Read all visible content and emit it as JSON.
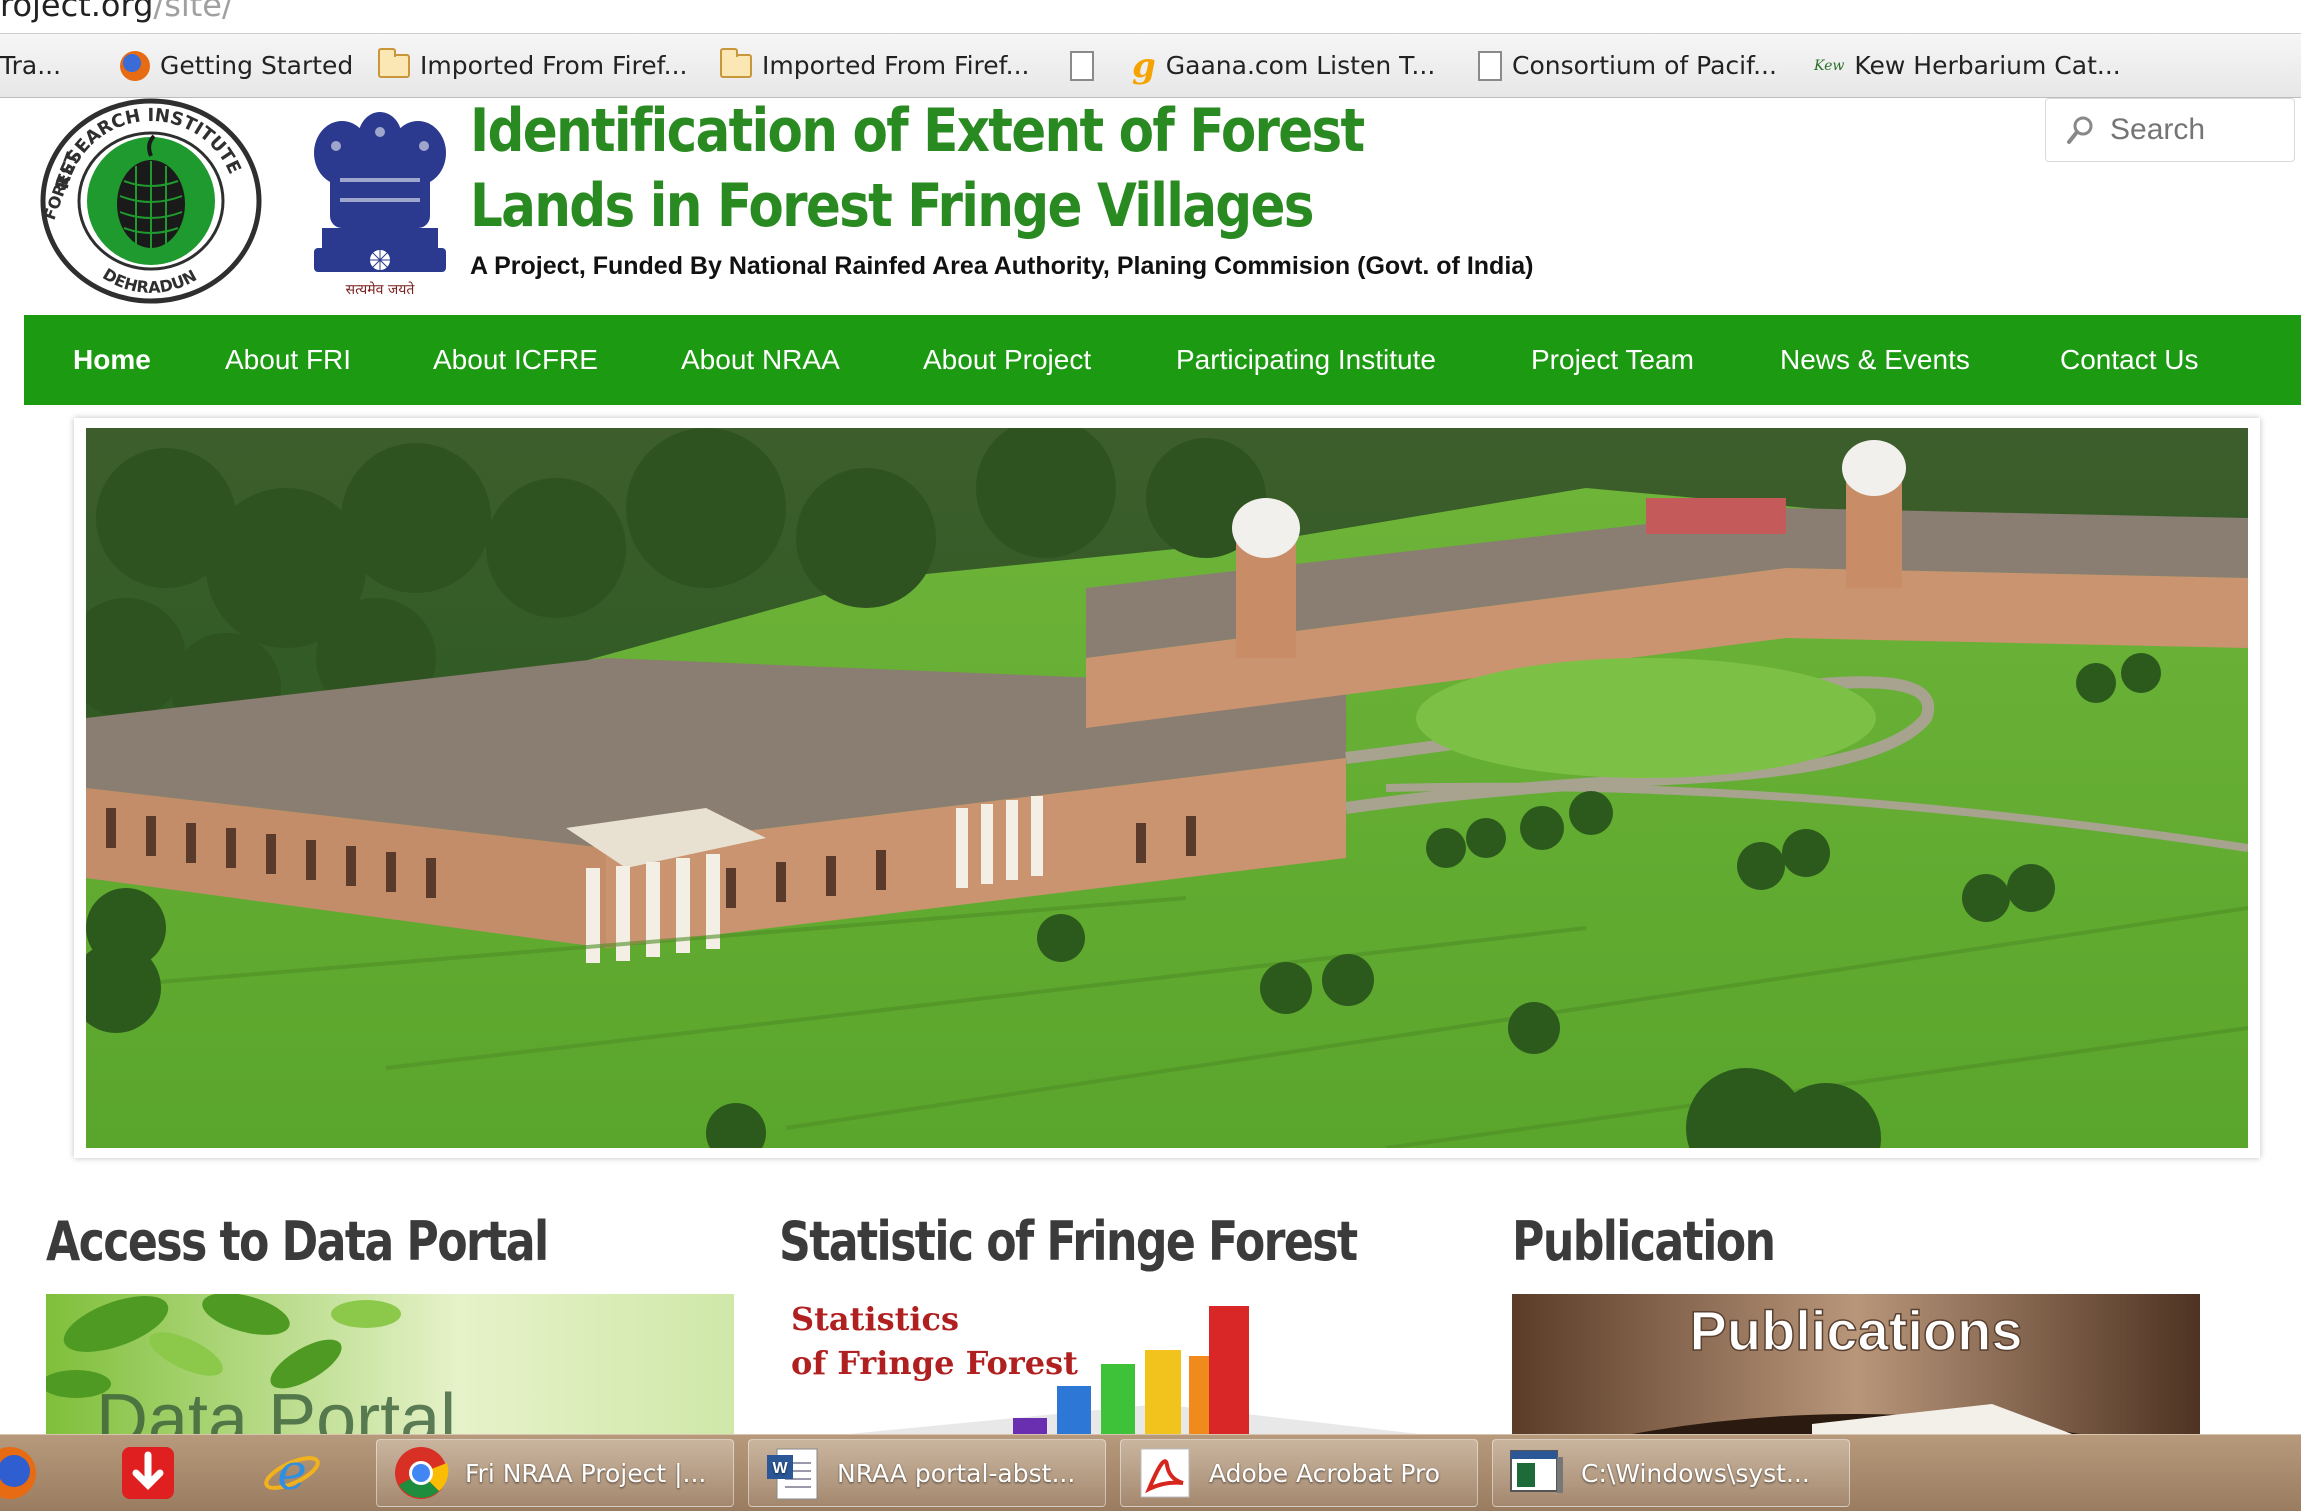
{
  "browser": {
    "address_text": "roject.org",
    "address_path": "/site/",
    "bookmarks": [
      {
        "icon": "none",
        "label": "Tra..."
      },
      {
        "icon": "firefox-icon",
        "label": "Getting Started"
      },
      {
        "icon": "folder-icon",
        "label": "Imported From Firef..."
      },
      {
        "icon": "folder-icon",
        "label": "Imported From Firef..."
      },
      {
        "icon": "page-icon",
        "label": ""
      },
      {
        "icon": "gaana-icon",
        "label": "Gaana.com Listen T..."
      },
      {
        "icon": "page-icon",
        "label": "Consortium of Pacif..."
      },
      {
        "icon": "kew-icon",
        "label": "Kew Herbarium Cat..."
      }
    ],
    "gaana_glyph": "g",
    "kew_glyph": "Kew"
  },
  "header": {
    "title_line1": "Identification of Extent of Forest",
    "title_line2": "Lands in Forest Fringe Villages",
    "subtitle": "A Project, Funded By National Rainfed Area Authority, Planing Commision (Govt. of India)",
    "logo_ring_top": "RESEARCH INSTITUTE",
    "logo_ring_left": "FOREST",
    "logo_ring_bottom": "DEHRADUN",
    "emblem_motto": "सत्यमेव जयते",
    "search_placeholder": "Search"
  },
  "nav": {
    "items": [
      "Home",
      "About FRI",
      "About ICFRE",
      "About NRAA",
      "About Project",
      "Participating Institute",
      "Project Team",
      "News & Events",
      "Contact Us"
    ],
    "active": "Home"
  },
  "sections": [
    {
      "title": "Access to Data Portal",
      "thumb_text": "Data Portal"
    },
    {
      "title": "Statistic of Fringe Forest",
      "thumb_text_line1": "Statistics",
      "thumb_text_line2": "of Fringe Forest"
    },
    {
      "title": "Publication",
      "thumb_text": "Publications"
    }
  ],
  "taskbar": {
    "items": [
      {
        "icon": "chrome-icon",
        "label": "Fri NRAA Project |..."
      },
      {
        "icon": "word-icon",
        "label": "NRAA portal-abst..."
      },
      {
        "icon": "acrobat-icon",
        "label": "Adobe Acrobat Pro"
      },
      {
        "icon": "cmd-icon",
        "label": "C:\\Windows\\syst..."
      }
    ]
  },
  "colors": {
    "brand_green": "#1c9a12",
    "title_green": "#2a8a22",
    "section_title": "#3b3b3b"
  }
}
